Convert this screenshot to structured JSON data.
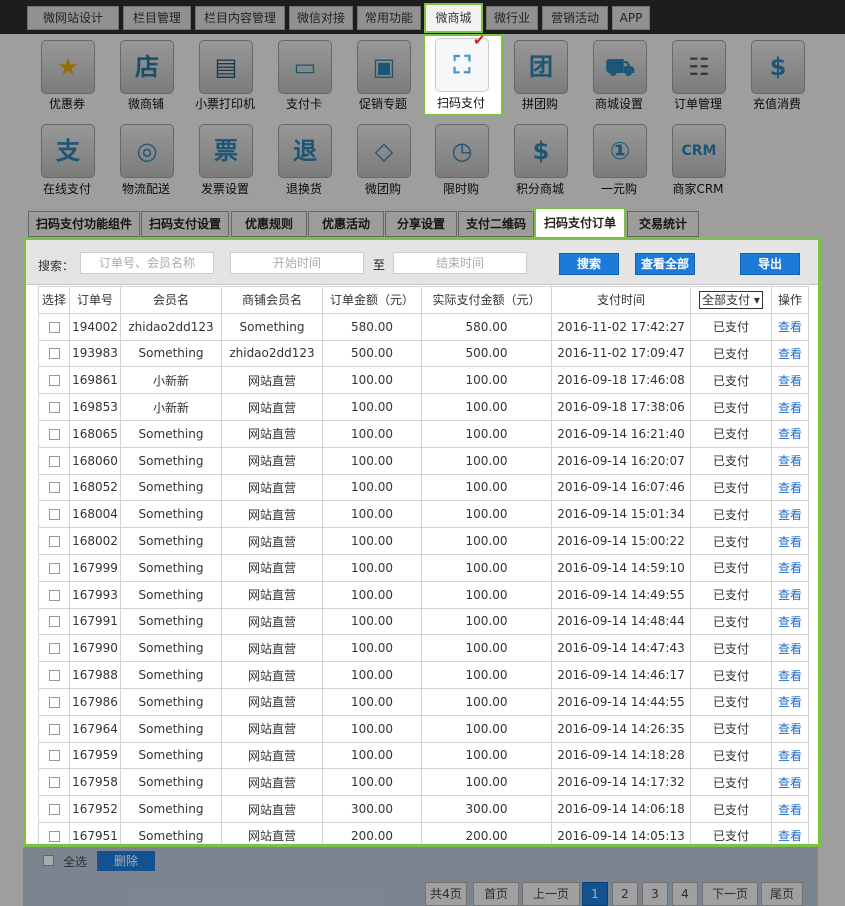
{
  "top_nav": [
    "微网站设计",
    "栏目管理",
    "栏目内容管理",
    "微信对接",
    "常用功能",
    "微商城",
    "微行业",
    "营销活动",
    "APP"
  ],
  "top_nav_active": 5,
  "icons_row1": [
    {
      "label": "优惠券",
      "icon": "star-icon"
    },
    {
      "label": "微商铺",
      "icon": "shop-icon"
    },
    {
      "label": "小票打印机",
      "icon": "printer-icon"
    },
    {
      "label": "支付卡",
      "icon": "card-icon"
    },
    {
      "label": "促销专题",
      "icon": "promo-icon"
    },
    {
      "label": "扫码支付",
      "icon": "scan-icon"
    },
    {
      "label": "拼团购",
      "icon": "group-buy-icon"
    },
    {
      "label": "商城设置",
      "icon": "cart-icon"
    },
    {
      "label": "订单管理",
      "icon": "order-icon"
    },
    {
      "label": "充值消费",
      "icon": "money-bag-icon"
    }
  ],
  "icons_row2": [
    {
      "label": "在线支付",
      "icon": "pay-icon",
      "glyph": "支"
    },
    {
      "label": "物流配送",
      "icon": "wheel-icon",
      "glyph": "◎"
    },
    {
      "label": "发票设置",
      "icon": "invoice-icon",
      "glyph": "票"
    },
    {
      "label": "退换货",
      "icon": "return-icon",
      "glyph": "退"
    },
    {
      "label": "微团购",
      "icon": "tag-icon",
      "glyph": "◇"
    },
    {
      "label": "限时购",
      "icon": "clock-icon",
      "glyph": "◷"
    },
    {
      "label": "积分商城",
      "icon": "points-icon",
      "glyph": "$"
    },
    {
      "label": "一元购",
      "icon": "one-yuan-icon",
      "glyph": "①"
    },
    {
      "label": "商家CRM",
      "icon": "crm-icon",
      "glyph": "CRM"
    }
  ],
  "tabs": [
    "扫码支付功能组件",
    "扫码支付设置",
    "优惠规则",
    "优惠活动",
    "分享设置",
    "支付二维码",
    "扫码支付订单",
    "交易统计"
  ],
  "tabs_active": 6,
  "search": {
    "label": "搜索：",
    "keyword_placeholder": "订单号、会员名称",
    "start_placeholder": "开始时间",
    "to_label": "至",
    "end_placeholder": "结束时间",
    "search_btn": "搜索",
    "view_all_btn": "查看全部",
    "export_btn": "导出"
  },
  "table": {
    "headers": [
      "选择",
      "订单号",
      "会员名",
      "商铺会员名",
      "订单金额（元）",
      "实际支付金额（元）",
      "支付时间",
      "全部支付",
      "操作"
    ],
    "action_label": "查看",
    "rows": [
      [
        "194002",
        "zhidao2dd123",
        "Something",
        "580.00",
        "580.00",
        "2016-11-02 17:42:27",
        "已支付"
      ],
      [
        "193983",
        "Something",
        "zhidao2dd123",
        "500.00",
        "500.00",
        "2016-11-02 17:09:47",
        "已支付"
      ],
      [
        "169861",
        "小新新",
        "网站直营",
        "100.00",
        "100.00",
        "2016-09-18 17:46:08",
        "已支付"
      ],
      [
        "169853",
        "小新新",
        "网站直营",
        "100.00",
        "100.00",
        "2016-09-18 17:38:06",
        "已支付"
      ],
      [
        "168065",
        "Something",
        "网站直营",
        "100.00",
        "100.00",
        "2016-09-14 16:21:40",
        "已支付"
      ],
      [
        "168060",
        "Something",
        "网站直营",
        "100.00",
        "100.00",
        "2016-09-14 16:20:07",
        "已支付"
      ],
      [
        "168052",
        "Something",
        "网站直营",
        "100.00",
        "100.00",
        "2016-09-14 16:07:46",
        "已支付"
      ],
      [
        "168004",
        "Something",
        "网站直营",
        "100.00",
        "100.00",
        "2016-09-14 15:01:34",
        "已支付"
      ],
      [
        "168002",
        "Something",
        "网站直营",
        "100.00",
        "100.00",
        "2016-09-14 15:00:22",
        "已支付"
      ],
      [
        "167999",
        "Something",
        "网站直营",
        "100.00",
        "100.00",
        "2016-09-14 14:59:10",
        "已支付"
      ],
      [
        "167993",
        "Something",
        "网站直营",
        "100.00",
        "100.00",
        "2016-09-14 14:49:55",
        "已支付"
      ],
      [
        "167991",
        "Something",
        "网站直营",
        "100.00",
        "100.00",
        "2016-09-14 14:48:44",
        "已支付"
      ],
      [
        "167990",
        "Something",
        "网站直营",
        "100.00",
        "100.00",
        "2016-09-14 14:47:43",
        "已支付"
      ],
      [
        "167988",
        "Something",
        "网站直营",
        "100.00",
        "100.00",
        "2016-09-14 14:46:17",
        "已支付"
      ],
      [
        "167986",
        "Something",
        "网站直营",
        "100.00",
        "100.00",
        "2016-09-14 14:44:55",
        "已支付"
      ],
      [
        "167964",
        "Something",
        "网站直营",
        "100.00",
        "100.00",
        "2016-09-14 14:26:35",
        "已支付"
      ],
      [
        "167959",
        "Something",
        "网站直营",
        "100.00",
        "100.00",
        "2016-09-14 14:18:28",
        "已支付"
      ],
      [
        "167958",
        "Something",
        "网站直营",
        "100.00",
        "100.00",
        "2016-09-14 14:17:32",
        "已支付"
      ],
      [
        "167952",
        "Something",
        "网站直营",
        "300.00",
        "300.00",
        "2016-09-14 14:06:18",
        "已支付"
      ],
      [
        "167951",
        "Something",
        "网站直营",
        "200.00",
        "200.00",
        "2016-09-14 14:05:13",
        "已支付"
      ]
    ]
  },
  "bottom": {
    "select_all": "全选",
    "delete_btn": "删除",
    "pagination": [
      "共4页",
      "首页",
      "上一页",
      "1",
      "2",
      "3",
      "4",
      "下一页",
      "尾页"
    ],
    "current_page": "1"
  },
  "colors": {
    "highlight": "#7cc242",
    "primary_button": "#1e7ad8",
    "link": "#1e6fcf"
  }
}
